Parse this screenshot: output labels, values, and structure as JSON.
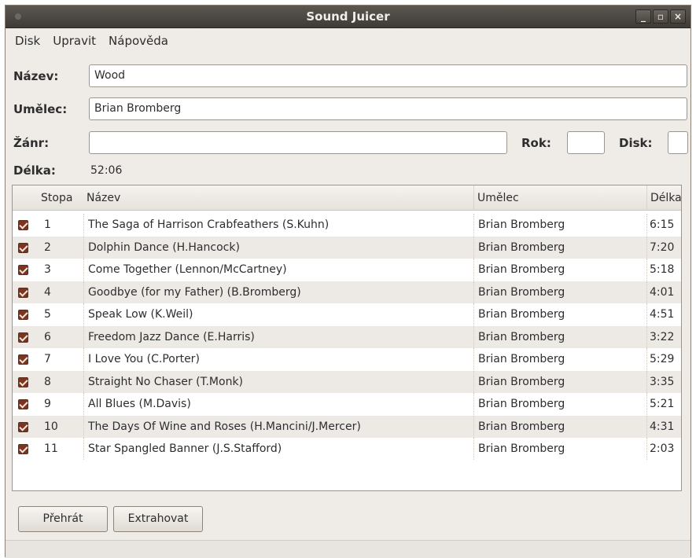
{
  "window": {
    "title": "Sound Juicer",
    "controls": {
      "minimize": "_",
      "maximize": "▫",
      "close": "×"
    }
  },
  "menu": [
    {
      "label": "Disk",
      "mnemonic_index": 0
    },
    {
      "label": "Upravit",
      "mnemonic_index": 0
    },
    {
      "label": "Nápověda",
      "mnemonic_index": 0
    }
  ],
  "form": {
    "title_label": "Název:",
    "title_value": "Wood",
    "artist_label": "Umělec:",
    "artist_value": "Brian Bromberg",
    "genre_label": "Žánr:",
    "genre_value": "",
    "year_label": "Rok:",
    "year_value": "",
    "disc_label": "Disk:",
    "disc_value": "",
    "duration_label": "Délka:",
    "duration_value": "52:06"
  },
  "tracks": {
    "columns": [
      "Stopa",
      "Název",
      "Umělec",
      "Délka"
    ],
    "rows": [
      {
        "checked": true,
        "number": "1",
        "title": "The Saga of Harrison Crabfeathers (S.Kuhn)",
        "artist": "Brian Bromberg",
        "duration": "6:15"
      },
      {
        "checked": true,
        "number": "2",
        "title": "Dolphin Dance (H.Hancock)",
        "artist": "Brian Bromberg",
        "duration": "7:20"
      },
      {
        "checked": true,
        "number": "3",
        "title": "Come Together (Lennon/McCartney)",
        "artist": "Brian Bromberg",
        "duration": "5:18"
      },
      {
        "checked": true,
        "number": "4",
        "title": "Goodbye (for my Father) (B.Bromberg)",
        "artist": "Brian Bromberg",
        "duration": "4:01"
      },
      {
        "checked": true,
        "number": "5",
        "title": "Speak Low (K.Weil)",
        "artist": "Brian Bromberg",
        "duration": "4:51"
      },
      {
        "checked": true,
        "number": "6",
        "title": "Freedom Jazz Dance (E.Harris)",
        "artist": "Brian Bromberg",
        "duration": "3:22"
      },
      {
        "checked": true,
        "number": "7",
        "title": "I Love You (C.Porter)",
        "artist": "Brian Bromberg",
        "duration": "5:29"
      },
      {
        "checked": true,
        "number": "8",
        "title": "Straight No Chaser (T.Monk)",
        "artist": "Brian Bromberg",
        "duration": "3:35"
      },
      {
        "checked": true,
        "number": "9",
        "title": "All Blues (M.Davis)",
        "artist": "Brian Bromberg",
        "duration": "5:21"
      },
      {
        "checked": true,
        "number": "10",
        "title": "The Days Of Wine and Roses (H.Mancini/J.Mercer)",
        "artist": "Brian Bromberg",
        "duration": "4:31"
      },
      {
        "checked": true,
        "number": "11",
        "title": "Star Spangled Banner (J.S.Stafford)",
        "artist": "Brian Bromberg",
        "duration": "2:03"
      }
    ]
  },
  "buttons": {
    "play": "Přehrát",
    "extract": "Extrahovat"
  },
  "colors": {
    "checkbox": "#7a3521",
    "titlebar": "#3e3b37",
    "window_bg": "#efebe7"
  }
}
